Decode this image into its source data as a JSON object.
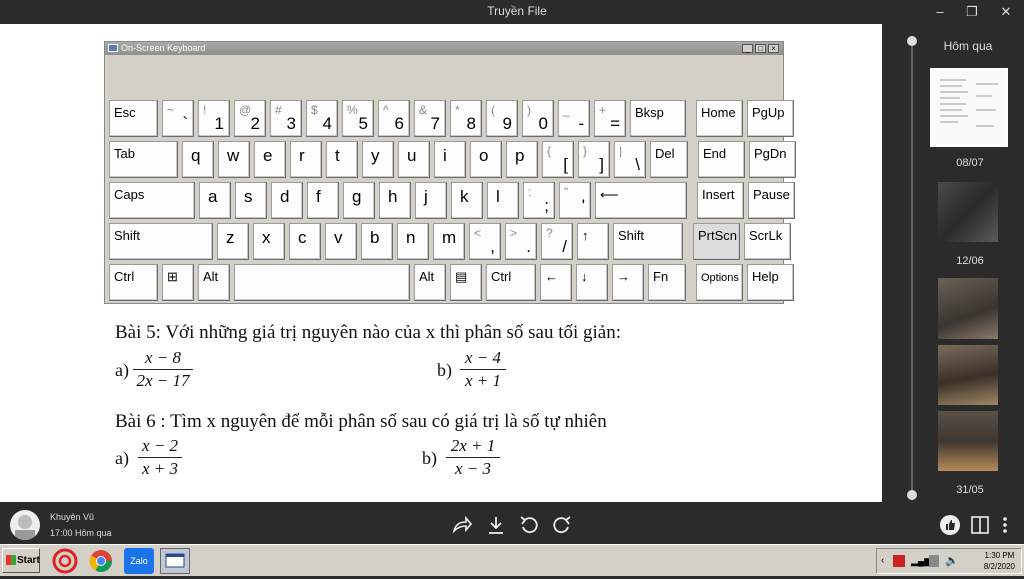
{
  "window": {
    "title": "Truyền File",
    "minimize_glyph": "–",
    "restore_glyph": "❐",
    "close_glyph": "✕"
  },
  "osk": {
    "title": "On-Screen Keyboard",
    "controls": [
      "_",
      "□",
      "×"
    ],
    "rows": [
      [
        {
          "label": "Esc",
          "w": 49
        },
        {
          "shift": "~",
          "main": "`",
          "w": 32
        },
        {
          "shift": "!",
          "main": "1",
          "w": 32
        },
        {
          "shift": "@",
          "main": "2",
          "w": 32
        },
        {
          "shift": "#",
          "main": "3",
          "w": 32
        },
        {
          "shift": "$",
          "main": "4",
          "w": 32
        },
        {
          "shift": "%",
          "main": "5",
          "w": 32
        },
        {
          "shift": "^",
          "main": "6",
          "w": 32
        },
        {
          "shift": "&",
          "main": "7",
          "w": 32
        },
        {
          "shift": "*",
          "main": "8",
          "w": 32
        },
        {
          "shift": "(",
          "main": "9",
          "w": 32
        },
        {
          "shift": ")",
          "main": "0",
          "w": 32
        },
        {
          "shift": "_",
          "main": "-",
          "w": 32
        },
        {
          "shift": "+",
          "main": "=",
          "w": 32
        },
        {
          "label": "Bksp",
          "w": 56,
          "gap": 0
        },
        {
          "label": "Home",
          "w": 47,
          "gap": 6
        },
        {
          "label": "PgUp",
          "w": 47
        }
      ],
      [
        {
          "label": "Tab",
          "w": 69
        },
        {
          "label": "q",
          "w": 32,
          "letter": true
        },
        {
          "label": "w",
          "w": 32,
          "letter": true
        },
        {
          "label": "e",
          "w": 32,
          "letter": true
        },
        {
          "label": "r",
          "w": 32,
          "letter": true
        },
        {
          "label": "t",
          "w": 32,
          "letter": true
        },
        {
          "label": "y",
          "w": 32,
          "letter": true
        },
        {
          "label": "u",
          "w": 32,
          "letter": true
        },
        {
          "label": "i",
          "w": 32,
          "letter": true
        },
        {
          "label": "o",
          "w": 32,
          "letter": true
        },
        {
          "label": "p",
          "w": 32,
          "letter": true
        },
        {
          "shift": "{",
          "main": "[",
          "w": 32
        },
        {
          "shift": "}",
          "main": "]",
          "w": 32
        },
        {
          "shift": "|",
          "main": "\\",
          "w": 32
        },
        {
          "label": "Del",
          "w": 38
        },
        {
          "label": "End",
          "w": 47,
          "gap": 6
        },
        {
          "label": "PgDn",
          "w": 47
        }
      ],
      [
        {
          "label": "Caps",
          "w": 86
        },
        {
          "label": "a",
          "w": 32,
          "letter": true
        },
        {
          "label": "s",
          "w": 32,
          "letter": true
        },
        {
          "label": "d",
          "w": 32,
          "letter": true
        },
        {
          "label": "f",
          "w": 32,
          "letter": true
        },
        {
          "label": "g",
          "w": 32,
          "letter": true
        },
        {
          "label": "h",
          "w": 32,
          "letter": true
        },
        {
          "label": "j",
          "w": 32,
          "letter": true
        },
        {
          "label": "k",
          "w": 32,
          "letter": true
        },
        {
          "label": "l",
          "w": 32,
          "letter": true
        },
        {
          "shift": ":",
          "main": ";",
          "w": 32
        },
        {
          "shift": "\"",
          "main": "'",
          "w": 32
        },
        {
          "label": "⟵",
          "w": 92
        },
        {
          "label": "Insert",
          "w": 47,
          "gap": 6
        },
        {
          "label": "Pause",
          "w": 47
        }
      ],
      [
        {
          "label": "Shift",
          "w": 104
        },
        {
          "label": "z",
          "w": 32,
          "letter": true
        },
        {
          "label": "x",
          "w": 32,
          "letter": true
        },
        {
          "label": "c",
          "w": 32,
          "letter": true
        },
        {
          "label": "v",
          "w": 32,
          "letter": true
        },
        {
          "label": "b",
          "w": 32,
          "letter": true
        },
        {
          "label": "n",
          "w": 32,
          "letter": true
        },
        {
          "label": "m",
          "w": 32,
          "letter": true
        },
        {
          "shift": "<",
          "main": ",",
          "w": 32
        },
        {
          "shift": ">",
          "main": ".",
          "w": 32
        },
        {
          "shift": "?",
          "main": "/",
          "w": 32
        },
        {
          "label": "↑",
          "w": 32
        },
        {
          "label": "Shift",
          "w": 70
        },
        {
          "label": "PrtScn",
          "w": 47,
          "gap": 6,
          "gray": true
        },
        {
          "label": "ScrLk",
          "w": 47
        }
      ],
      [
        {
          "label": "Ctrl",
          "w": 49
        },
        {
          "label": "⊞",
          "w": 32
        },
        {
          "label": "Alt",
          "w": 32
        },
        {
          "label": "",
          "w": 176
        },
        {
          "label": "Alt",
          "w": 32
        },
        {
          "label": "▤",
          "w": 32
        },
        {
          "label": "Ctrl",
          "w": 50
        },
        {
          "label": "←",
          "w": 32
        },
        {
          "label": "↓",
          "w": 32
        },
        {
          "label": "→",
          "w": 32
        },
        {
          "label": "Fn",
          "w": 38
        },
        {
          "label": "Options",
          "w": 47,
          "gap": 6,
          "small": true
        },
        {
          "label": "Help",
          "w": 47
        }
      ]
    ]
  },
  "document": {
    "bai5": "Bài 5: Với những giá trị nguyên nào của x thì phân số sau tối giản:",
    "bai5_a_label": "a)",
    "bai5_a_num": "x − 8",
    "bai5_a_den": "2x − 17",
    "bai5_b_label": "b)",
    "bai5_b_num": "x − 4",
    "bai5_b_den": "x + 1",
    "bai6": "Bài 6 : Tìm  x nguyên để mỗi phân số sau có giá trị  là số tự nhiên",
    "bai6_a_label": "a)",
    "bai6_a_num": "x − 2",
    "bai6_a_den": "x + 3",
    "bai6_b_label": "b)",
    "bai6_b_num": "2x + 1",
    "bai6_b_den": "x − 3"
  },
  "timeline": {
    "header": "Hôm qua",
    "dates": [
      "08/07",
      "12/06",
      "31/05"
    ]
  },
  "sender": {
    "name": "Khuyên Vũ",
    "time": "17:00 Hôm qua"
  },
  "taskbar": {
    "start_label": "Start",
    "clock_time": "1:30 PM",
    "clock_date": "8/2/2020",
    "zalo_label": "Zalo"
  },
  "colors": {
    "dark_bg": "#2b2b2b",
    "taskbar_bg": "#d4d0c8"
  }
}
